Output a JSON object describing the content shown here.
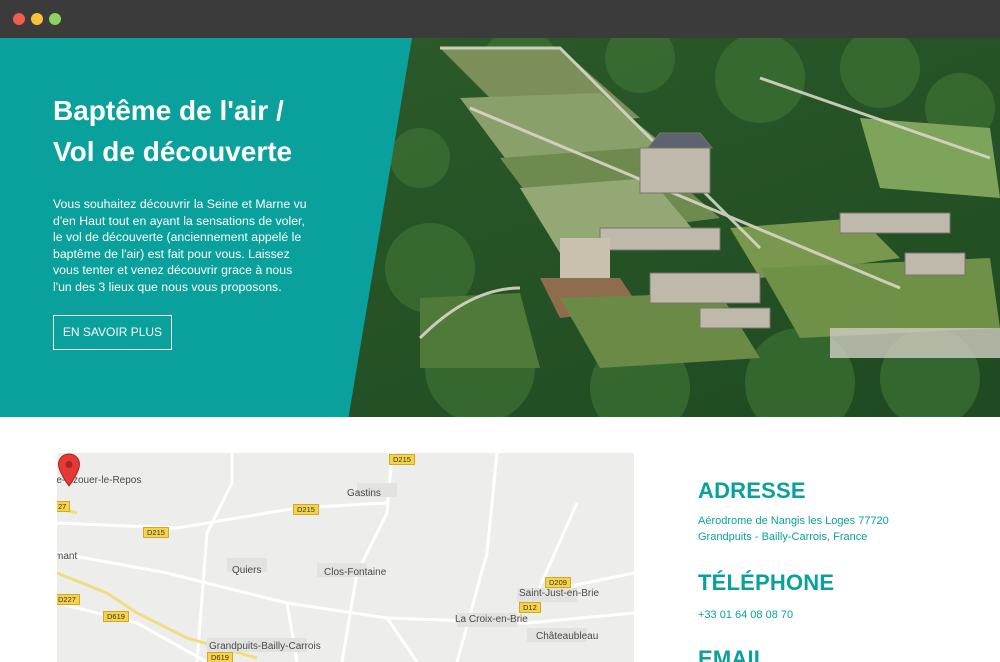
{
  "colors": {
    "accent": "#0aa19c",
    "chrome": "#3b3b3b",
    "map_bg": "#ededeb",
    "pin": "#e53935"
  },
  "hero": {
    "title_line1": "Baptême de l'air /",
    "title_line2": "Vol de découverte",
    "description": "Vous souhaitez découvrir la Seine et Marne vu d'en Haut tout en ayant la sensations de voler, le vol de découverte (anciennement appelé le baptême de l'air) est fait pour vous. Laissez vous tenter et venez découvrir grace à nous l'un des 3 lieux que nous vous proposons.",
    "button_label": "EN SAVOIR PLUS",
    "image_icon": "aerial-chateau-photo"
  },
  "map": {
    "places": {
      "ozouer": "re-Ozouer-le-Repos",
      "gastins": "Gastins",
      "quiers": "Quiers",
      "clos_fontaine": "Clos-Fontaine",
      "saint_just": "Saint-Just-en-Brie",
      "la_croix": "La Croix-en-Brie",
      "chateaubleau": "Châteaubleau",
      "grandpuits": "Grandpuits-Bailly-Carrois",
      "mant": "mant"
    },
    "roads": {
      "d215_top": "D215",
      "d215_mid": "D215",
      "d215_left": "D215",
      "d27": "27",
      "d227": "D227",
      "d619": "D619",
      "d619_bottom": "D619",
      "d209": "D209",
      "d12": "D12"
    },
    "marker_icon": "map-pin-icon"
  },
  "contact": {
    "address_title": "ADRESSE",
    "address_line1": "Aérodrome de Nangis les Loges 77720",
    "address_line2": "Grandpuits - Bailly-Carrois, France",
    "phone_title": "TÉLÉPHONE",
    "phone": "+33 01 64 08 08 70",
    "email_title": "EMAIL"
  }
}
